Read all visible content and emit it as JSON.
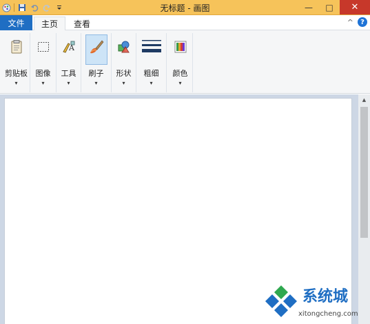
{
  "window": {
    "title": "无标题 - 画图",
    "minimize": "—",
    "maximize": "□",
    "close": "✕"
  },
  "quick_access": {
    "icons": [
      "paint-app-icon",
      "save-icon",
      "undo-icon",
      "redo-icon",
      "customize-qat-icon"
    ]
  },
  "tabs": {
    "file": "文件",
    "home": "主页",
    "view": "查看",
    "collapse": "^",
    "help": "?"
  },
  "ribbon": {
    "groups": [
      {
        "label": "剪贴板",
        "icon": "clipboard-icon",
        "caret": "▾"
      },
      {
        "label": "图像",
        "icon": "image-select-icon",
        "caret": "▾"
      },
      {
        "label": "工具",
        "icon": "tools-icon",
        "caret": "▾"
      },
      {
        "label": "刷子",
        "icon": "brush-icon",
        "caret": "▾",
        "selected": true
      },
      {
        "label": "形状",
        "icon": "shapes-icon",
        "caret": "▾"
      },
      {
        "label": "粗细",
        "icon": "line-width-icon",
        "caret": "▾"
      },
      {
        "label": "颜色",
        "icon": "colors-icon",
        "caret": "▾"
      }
    ]
  },
  "scrollbar": {
    "up": "▲"
  },
  "watermark": {
    "text": "系统城",
    "url": "xitongcheng.com",
    "colors": {
      "blue": "#1f6ec3",
      "green": "#2fa84f"
    }
  },
  "colors": {
    "titlebar": "#f6c35a",
    "file_tab": "#1f6ec3",
    "close_button": "#c7382a",
    "workspace": "#cdd7e5"
  }
}
